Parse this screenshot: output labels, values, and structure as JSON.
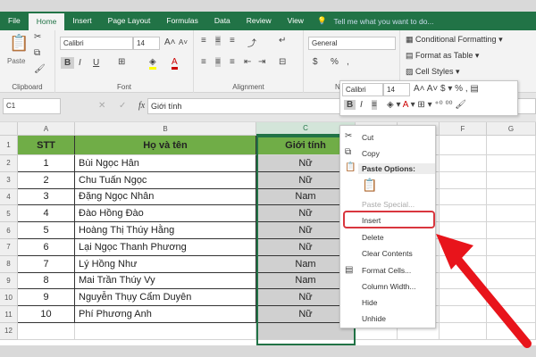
{
  "ribbon_tabs": [
    "File",
    "Home",
    "Insert",
    "Page Layout",
    "Formulas",
    "Data",
    "Review",
    "View"
  ],
  "active_tab": "Home",
  "tell_me": "Tell me what you want to do...",
  "clipboard": {
    "paste": "Paste",
    "label": "Clipboard"
  },
  "font": {
    "name": "Calibri",
    "size": "14",
    "label": "Font",
    "bold": "B",
    "italic": "I",
    "underline": "U"
  },
  "alignment": {
    "label": "Alignment"
  },
  "number": {
    "format": "General",
    "label": "N",
    "currency": "$",
    "percent": "%",
    "comma": ","
  },
  "styles": {
    "conditional": "Conditional Formatting",
    "format_table": "Format as Table",
    "cell_styles": "Cell Styles"
  },
  "formula_bar": {
    "name_box": "C1",
    "fx": "fx",
    "value": "Giới tính"
  },
  "columns": [
    "A",
    "B",
    "C",
    "D",
    "E",
    "F",
    "G"
  ],
  "rows": [
    "1",
    "2",
    "3",
    "4",
    "5",
    "6",
    "7",
    "8",
    "9",
    "10",
    "11",
    "12"
  ],
  "table": {
    "headers": [
      "STT",
      "Họ và tên",
      "Giới tính"
    ],
    "rows": [
      [
        "1",
        "Bùi Ngọc Hân",
        "Nữ"
      ],
      [
        "2",
        "Chu Tuấn Ngọc",
        "Nữ"
      ],
      [
        "3",
        "Đặng Ngọc Nhân",
        "Nam"
      ],
      [
        "4",
        "Đào Hồng Đào",
        "Nữ"
      ],
      [
        "5",
        "Hoàng Thị Thúy Hằng",
        "Nữ"
      ],
      [
        "6",
        "Lại Ngọc Thanh Phương",
        "Nữ"
      ],
      [
        "7",
        "Lý Hồng Như",
        "Nam"
      ],
      [
        "8",
        "Mai Trần Thúy Vy",
        "Nam"
      ],
      [
        "9",
        "Nguyễn Thụy Cẩm Duyên",
        "Nữ"
      ],
      [
        "10",
        "Phí Phương Anh",
        "Nữ"
      ]
    ]
  },
  "mini_toolbar": {
    "font": "Calibri",
    "size": "14"
  },
  "context_menu": {
    "cut": "Cut",
    "copy": "Copy",
    "paste_options": "Paste Options:",
    "paste_special": "Paste Special...",
    "insert": "Insert",
    "delete": "Delete",
    "clear": "Clear Contents",
    "format_cells": "Format Cells...",
    "column_width": "Column Width...",
    "hide": "Hide",
    "unhide": "Unhide"
  },
  "colors": {
    "excel_green": "#217346",
    "header_fill": "#70ad47",
    "selected_fill": "#d0d0d0",
    "highlight": "#d9363e",
    "arrow": "#e8141b"
  }
}
